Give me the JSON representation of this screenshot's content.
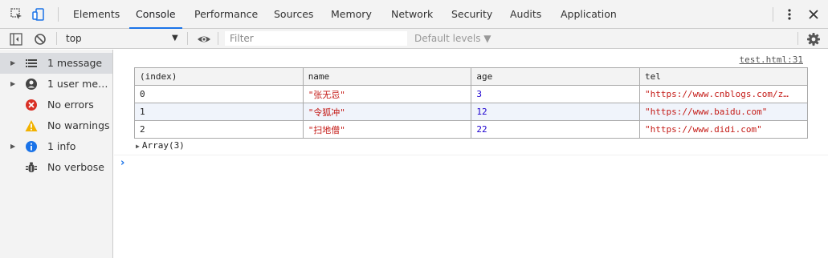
{
  "tabs": [
    "Elements",
    "Console",
    "Performance",
    "Sources",
    "Memory",
    "Network",
    "Security",
    "Audits",
    "Application"
  ],
  "active_tab": "Console",
  "toolbar": {
    "context": "top",
    "filter_placeholder": "Filter",
    "levels_label": "Default levels ▼"
  },
  "sidebar": {
    "items": [
      {
        "label": "1 message",
        "icon": "list-icon"
      },
      {
        "label": "1 user mess...",
        "icon": "user-icon"
      },
      {
        "label": "No errors",
        "icon": "error-icon"
      },
      {
        "label": "No warnings",
        "icon": "warning-icon"
      },
      {
        "label": "1 info",
        "icon": "info-icon"
      },
      {
        "label": "No verbose",
        "icon": "bug-icon"
      }
    ]
  },
  "console": {
    "source_link": "test.html:31",
    "table": {
      "headers": [
        "(index)",
        "name",
        "age",
        "tel"
      ],
      "rows": [
        [
          "0",
          "\"张无忌\"",
          "3",
          "\"https://www.cnblogs.com/z…"
        ],
        [
          "1",
          "\"令狐冲\"",
          "12",
          "\"https://www.baidu.com\""
        ],
        [
          "2",
          "\"扫地僧\"",
          "22",
          "\"https://www.didi.com\""
        ]
      ]
    },
    "array_summary": "Array(3)",
    "prompt": "›"
  },
  "colors": {
    "accent": "#1a73e8",
    "string": "#c41a16",
    "number": "#1c00cf",
    "error": "#d93025",
    "warning": "#f2b200",
    "info": "#1a73e8"
  }
}
